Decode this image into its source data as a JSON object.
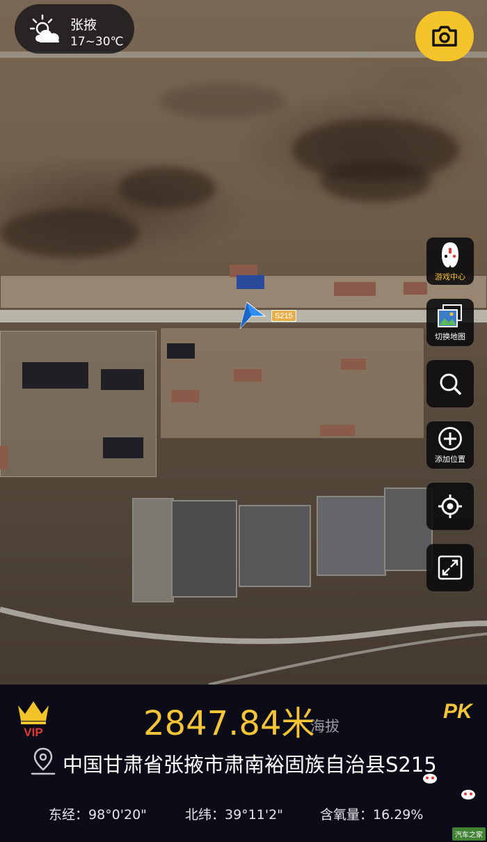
{
  "weather": {
    "city": "张掖",
    "temperature": "17~30℃",
    "icon": "partly-cloudy-icon"
  },
  "map": {
    "road_label": "S215"
  },
  "toolbar": {
    "game_center": "游戏中心",
    "switch_map": "切换地图",
    "add_location": "添加位置"
  },
  "panel": {
    "altitude_value": "2847.84米",
    "altitude_label": "海拔",
    "pk_label": "PK",
    "vip_label": "VIP",
    "location": "中国甘肃省张掖市肃南裕固族自治县S215",
    "longitude": "东经：98°0'20\"",
    "latitude": "北纬：39°11'2\"",
    "oxygen": "含氧量：16.29%"
  },
  "watermark": "汽车之家",
  "colors": {
    "accent": "#f3c32b",
    "panel_bg": "#0b0c18",
    "nav_arrow": "#2f8cf0"
  }
}
